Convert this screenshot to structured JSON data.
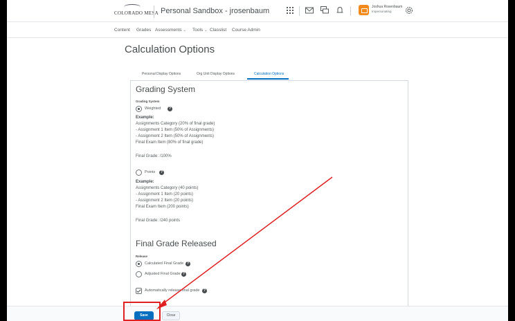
{
  "header": {
    "logo_text": "COLORADO MESA",
    "org_name": "Personal Sandbox - jrosenbaum",
    "user_name": "Joshua Rosenbaum",
    "user_role": "Impersonating",
    "icons": [
      "waffle-icon",
      "mail-icon",
      "chat-icon",
      "bell-icon",
      "gear-icon"
    ]
  },
  "subnav": {
    "content": "Content",
    "grades": "Grades",
    "assessments": "Assessments",
    "tools": "Tools",
    "classlist": "Classlist",
    "course_admin": "Course Admin"
  },
  "page_title": "Calculation Options",
  "tabs": [
    {
      "label": "Personal Display Options"
    },
    {
      "label": "Org Unit Display Options"
    },
    {
      "label": "Calculation Options",
      "active": true
    }
  ],
  "grading_system": {
    "heading": "Grading System",
    "label": "Grading System",
    "weighted": {
      "label": "Weighted",
      "example_head": "Example:",
      "lines": [
        "Assignments Category (20% of final grade)",
        "- Assignment 1 Item (50% of Assignments)",
        "- Assignment 2 Item (50% of Assignments)",
        "Final Exam Item (80% of final grade)"
      ],
      "final": "Final Grade: /100%"
    },
    "points": {
      "label": "Points",
      "example_head": "Example:",
      "lines": [
        "Assignments Category (40 points)",
        "- Assignment 1 Item (20 points)",
        "- Assignment 2 Item (20 points)",
        "Final Exam Item (200 points)"
      ],
      "final": "Final Grade: /240 points"
    }
  },
  "final_grade_released": {
    "heading": "Final Grade Released",
    "label": "Release",
    "calculated": "Calculated Final Grade",
    "adjusted": "Adjusted Final Grade",
    "auto_release": "Automatically release final grade"
  },
  "footer": {
    "save": "Save",
    "close": "Close"
  },
  "colors": {
    "brand_blue": "#006fbf",
    "annotation_red": "#e02020",
    "avatar_orange": "#f28a1b"
  }
}
